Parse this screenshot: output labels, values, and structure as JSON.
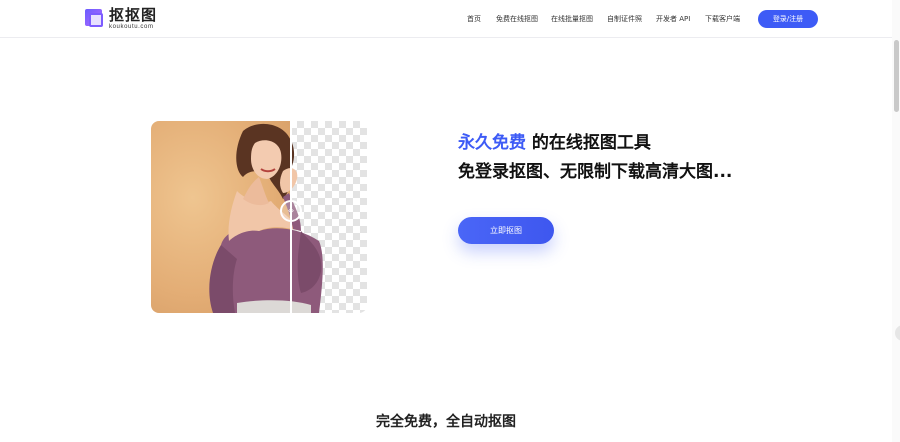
{
  "header": {
    "logo_name": "抠抠图",
    "logo_domain": "koukoutu.com",
    "nav": [
      {
        "label": "首页"
      },
      {
        "label": "免费在线抠图"
      },
      {
        "label": "在线批量抠图"
      },
      {
        "label": "自制证件照"
      },
      {
        "label": "开发者 API"
      },
      {
        "label": "下载客户端"
      }
    ],
    "login_label": "登录/注册"
  },
  "hero": {
    "headline_accent": "永久免费",
    "headline_rest": " 的在线抠图工具",
    "subline": "免登录抠图、无限制下载高清大图...",
    "cta_label": "立即抠图",
    "divider_icon": "compare-arrows-icon"
  },
  "section": {
    "title": "完全免费，全自动抠图"
  },
  "colors": {
    "accent": "#3d5bf6",
    "hero_bg": "#e3ad75",
    "sweater": "#8e5a7b"
  }
}
